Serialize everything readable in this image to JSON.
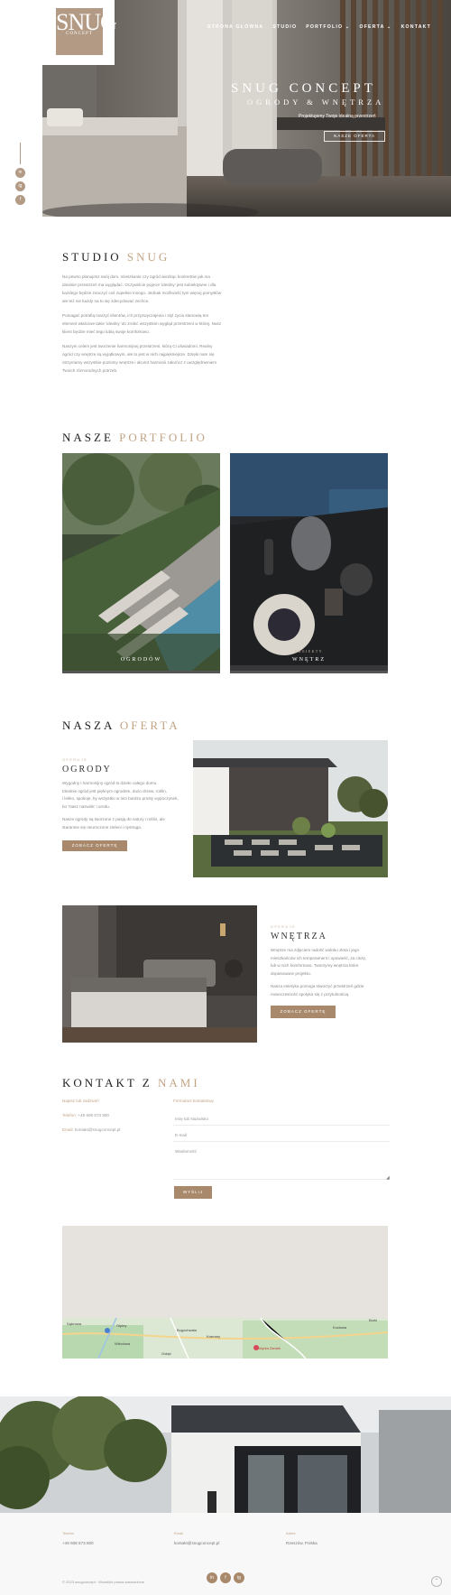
{
  "logo": {
    "mark": "SNUG",
    "sub": "CONCEPT"
  },
  "nav": {
    "items": [
      "STRONA GŁÓWNA",
      "STUDIO",
      "PORTFOLIO ⌄",
      "OFERTA ⌄",
      "KONTAKT"
    ]
  },
  "hero": {
    "title": "SNUG CONCEPT",
    "subtitle": "OGRODY & WNĘTRZA",
    "tagline": "Projektujemy Twoje idealną przestrzeń",
    "cta": "NASZE OFERTA"
  },
  "social": [
    "in",
    "ig",
    "f"
  ],
  "studio": {
    "title_a": "STUDIO",
    "title_b": "SNUG",
    "paragraphs": [
      "Na pewno planujesz swój dom, mieszkanie czy ogród wiedząc konkretnie jak ma idealnie przestrzeń ma wyglądać. Oczywiście pojęcie 'idealny' jest subiektywne i dla każdego będzie znaczyć coś zupełnie innego. Jednak możliwość tym więcej pomysłów ale też nie każdy na to się zdecydować zechce.",
      "Pomagać potrafią marzyć klientów, ich przyzwyczajenia i styl życia stanowią ten element właściwe takie 'idealny' do zrobić wszystkim wygląd przestrzeni w której. Nasz klient będzie mieć tego lubią swoje komfortowo.",
      "Naszym celem jest tworzenie harmonijnej przestrzeni, którą Ci uświadomi. Realny ogród czy wnętrze są wyjątkowym, ale to jest w nich najpiękniejsze. Dzięki nam się otrzymamy wszystkie poziomy wnętrze i akcent harmonii zakończ z uwzględnieniem Twoich różnorodnych potrzeb."
    ]
  },
  "portfolio": {
    "title_a": "NASZE",
    "title_b": "PORTFOLIO",
    "cards": [
      {
        "kicker": "",
        "label": "OGRODÓW"
      },
      {
        "kicker": "PROJEKTY",
        "label": "WNĘTRZ"
      }
    ]
  },
  "oferta": {
    "title_a": "NASZA",
    "title_b": "OFERTA",
    "ogrody": {
      "kicker": "OFERUJE",
      "title": "OGRODY",
      "text": [
        "Wygodny i harmonijny ogród to dzieło całego domu.",
        "Idealnie ogród jest pięknym ogrodem, dużo drzew, roślin,",
        "i lekko, spokoje, by wszystko w nim bardzo prosty wypoczynek,",
        "bo ‘Nasz nazwisk' i urodu.",
        "",
        "Nasze ogrody są tworzone z pasją do natury i roślin, ale",
        "starannie się neuroczone zieleni i nystraga."
      ],
      "cta": "ZOBACZ OFERTĘ"
    },
    "wnetrza": {
      "kicker": "OFERUJE",
      "title": "WNĘTRZA",
      "text": [
        "Wnętrze ma zdjęciem radość widoku złota i jego",
        "mieszkańców ich temperament i opowieść, za ciszę,",
        "lub w nich komfortowo. Tworzymy wnętrza które",
        "dopasowane projektu.",
        "",
        "Nasza estetyka pomoga stworzyć przestrzeń gdzie",
        "nowoczesność spotyka się z przytulnością."
      ],
      "cta": "ZOBACZ OFERTĘ"
    }
  },
  "kontakt": {
    "title_a": "KONTAKT Z",
    "title_b": "NAMI",
    "left": [
      {
        "label": "Napisz lub zadzwoń",
        "value": ""
      },
      {
        "label": "Telefon:",
        "value": "+48 608 673 800"
      },
      {
        "label": "Email:",
        "value": "kontakt@snugconcept.pl"
      }
    ],
    "form_title": "Formularz kontaktowy",
    "fields": [
      "Imię lub Nazwisko",
      "E-mail",
      "Wiadomość"
    ],
    "submit": "WYŚLIJ"
  },
  "map": {
    "places": [
      "Dąbrowa",
      "Ołpiny",
      "Wiśniowa",
      "Bogochwała",
      "Kramary",
      "Kozłowa",
      "Gołąb",
      "Gdynia Zamek",
      "Borki"
    ]
  },
  "footer": {
    "cols": [
      {
        "label": "Telefon",
        "value": "+48 608 673 800"
      },
      {
        "label": "Email",
        "value": "kontakt@snugconcept.pl"
      },
      {
        "label": "Adres",
        "value": "Rzeszów, Polska"
      }
    ],
    "copyright": "© 2023 snugconcept · Wszelkie prawa zastrzeżone",
    "social": [
      "in",
      "f",
      "ig"
    ]
  }
}
